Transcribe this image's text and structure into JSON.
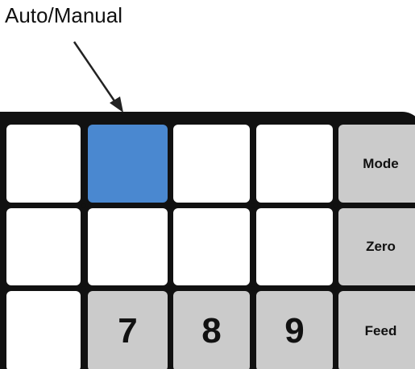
{
  "callout": {
    "label": "Auto/Manual"
  },
  "keypad": {
    "function_keys": {
      "mode": "Mode",
      "zero": "Zero",
      "feed": "Feed"
    },
    "digits": {
      "seven": "7",
      "eight": "8",
      "nine": "9"
    },
    "colors": {
      "frame": "#111111",
      "key_white": "#ffffff",
      "key_gray": "#cbcbcb",
      "key_active": "#4a88d0"
    }
  }
}
